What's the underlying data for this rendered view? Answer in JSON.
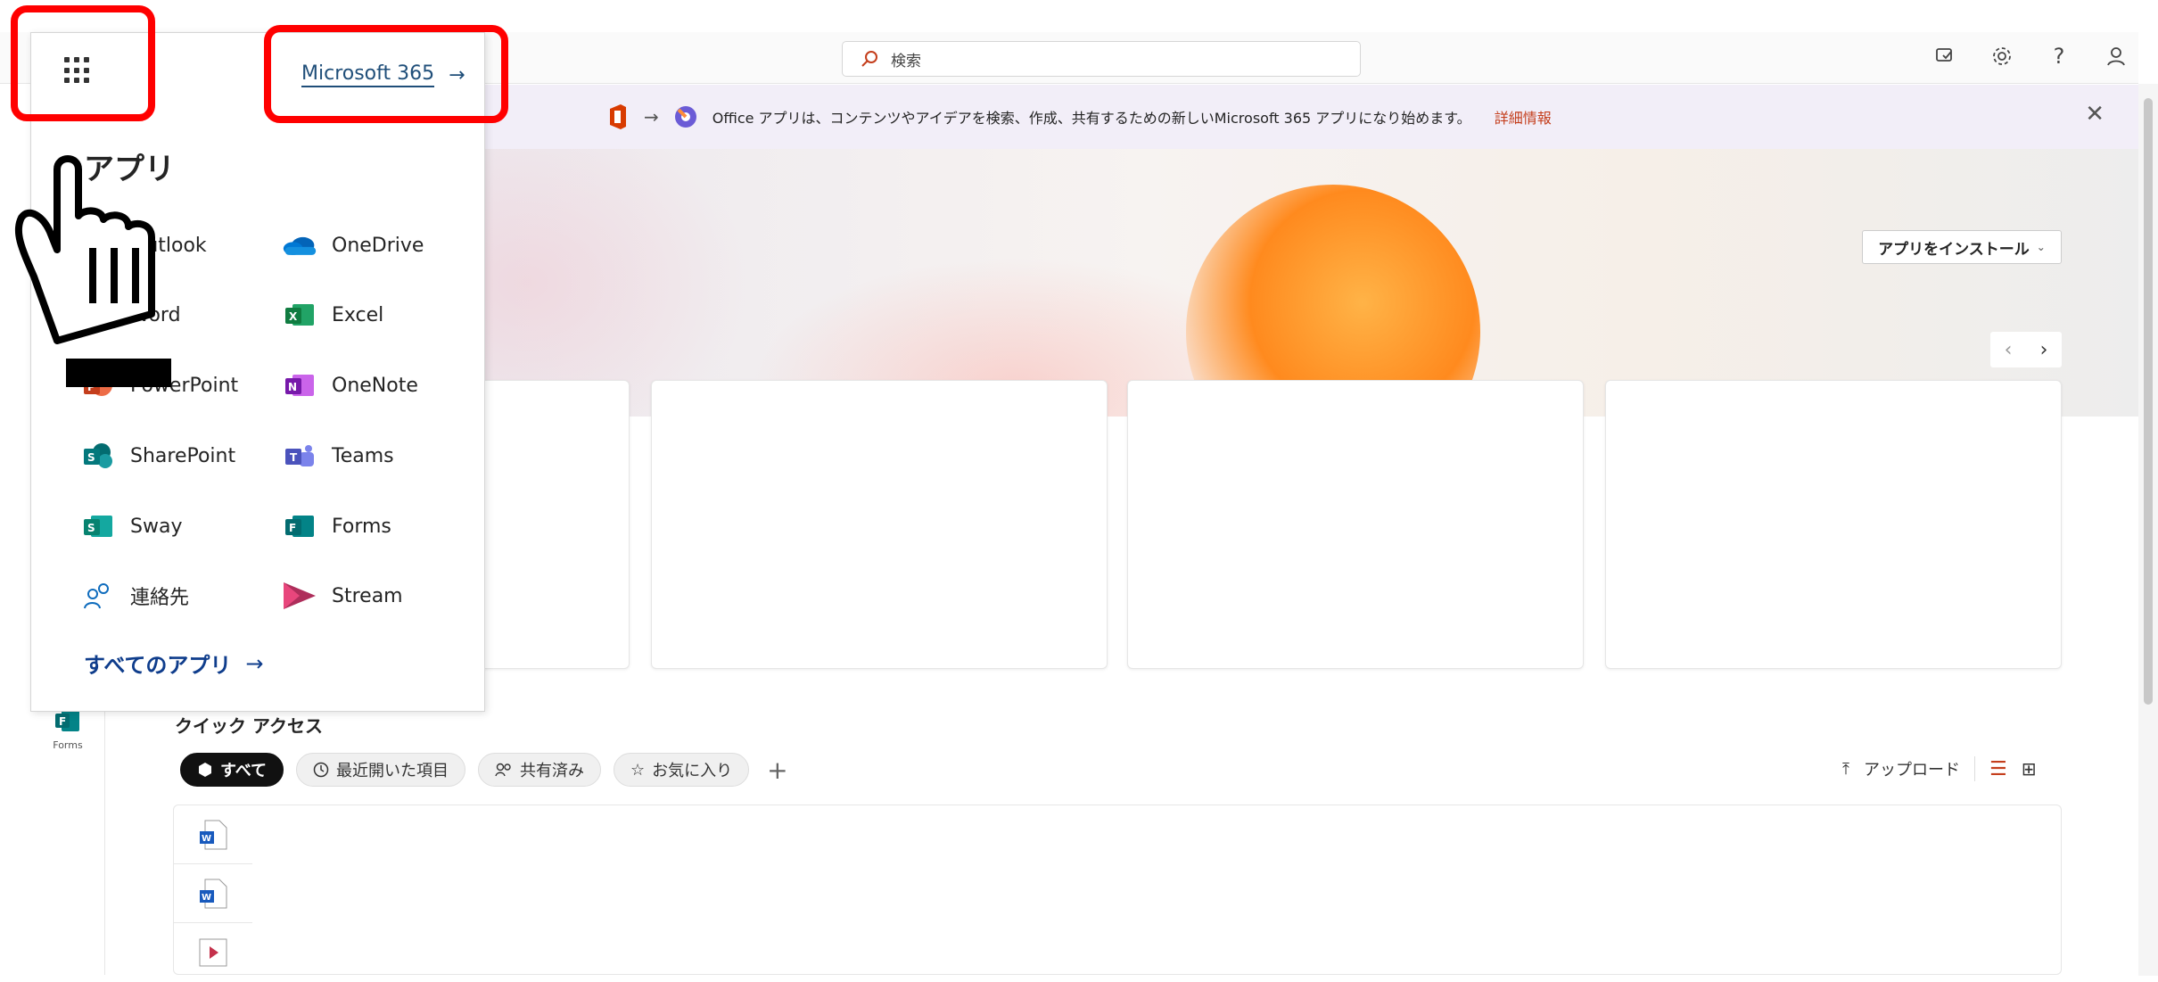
{
  "header": {
    "search_placeholder": "検索",
    "icons": [
      "feedback-icon",
      "gear-icon",
      "help-icon",
      "account-icon"
    ]
  },
  "banner": {
    "text": "Office アプリは、コンテンツやアイデアを検索、作成、共有するための新しいMicrosoft 365 アプリになり始めます。",
    "link": "詳細情報"
  },
  "hero": {
    "install_label": "アプリをインストール"
  },
  "launcher": {
    "brand_link": "Microsoft 365",
    "apps_title": "アプリ",
    "apps": [
      {
        "label": "Outlook",
        "icon": "outlook-icon"
      },
      {
        "label": "OneDrive",
        "icon": "onedrive-icon"
      },
      {
        "label": "Word",
        "icon": "word-icon"
      },
      {
        "label": "Excel",
        "icon": "excel-icon"
      },
      {
        "label": "PowerPoint",
        "icon": "powerpoint-icon"
      },
      {
        "label": "OneNote",
        "icon": "onenote-icon"
      },
      {
        "label": "SharePoint",
        "icon": "sharepoint-icon"
      },
      {
        "label": "Teams",
        "icon": "teams-icon"
      },
      {
        "label": "Sway",
        "icon": "sway-icon"
      },
      {
        "label": "Forms",
        "icon": "forms-icon"
      },
      {
        "label": "連絡先",
        "icon": "contacts-icon"
      },
      {
        "label": "Stream",
        "icon": "stream-icon"
      }
    ],
    "all_apps": "すべてのアプリ"
  },
  "rail": {
    "forms_label": "Forms"
  },
  "quick_access": {
    "title": "クイック アクセス",
    "chips": [
      "すべて",
      "最近開いた項目",
      "共有済み",
      "お気に入り"
    ],
    "upload": "アップロード"
  },
  "colors": {
    "highlight": "#ff0000",
    "link_orange": "#c43e1c",
    "brand_blue": "#1f4e79"
  }
}
